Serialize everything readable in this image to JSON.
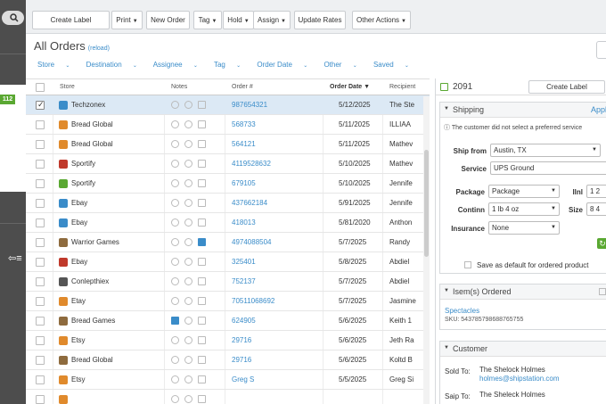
{
  "toolbar": {
    "create_label": "Create Label",
    "print": "Print",
    "new_order": "New Order",
    "tag": "Tag",
    "hold": "Hold",
    "assign": "Assign",
    "update_rates": "Update Rates",
    "other_actions": "Other Actions"
  },
  "sidebar": {
    "badge": "112"
  },
  "header": {
    "title": "All Orders",
    "reload": "(reload)"
  },
  "filters": [
    "Store",
    "Destination",
    "Assignee",
    "Tag",
    "Order Date",
    "Other",
    "Saved"
  ],
  "columns": {
    "store": "Store",
    "notes": "Notes",
    "order": "Order #",
    "date": "Order Date",
    "recipient": "Recipient"
  },
  "rows": [
    {
      "store": "Techzonex",
      "order": "987654321",
      "date": "5/12/2025",
      "recipient": "The Ste",
      "icon_color": "#3a8cc9",
      "selected": true,
      "note": false
    },
    {
      "store": "Bread Global",
      "order": "568733",
      "date": "5/11/2025",
      "recipient": "ILLIAA",
      "icon_color": "#e08a2c",
      "selected": false,
      "note": false
    },
    {
      "store": "Bread Global",
      "order": "564121",
      "date": "5/11/2025",
      "recipient": "Mathev",
      "icon_color": "#e08a2c",
      "selected": false,
      "note": false
    },
    {
      "store": "Sportify",
      "order": "4119528632",
      "date": "5/10/2025",
      "recipient": "Mathev",
      "icon_color": "#c0392b",
      "selected": false,
      "note": false
    },
    {
      "store": "Sportify",
      "order": "679105",
      "date": "5/10/2025",
      "recipient": "Jennife",
      "icon_color": "#5aa832",
      "selected": false,
      "note": false
    },
    {
      "store": "Ebay",
      "order": "437662184",
      "date": "5/91/2025",
      "recipient": "Jennife",
      "icon_color": "#3a8cc9",
      "selected": false,
      "note": false
    },
    {
      "store": "Ebay",
      "order": "418013",
      "date": "5/81/2020",
      "recipient": "Anthon",
      "icon_color": "#3a8cc9",
      "selected": false,
      "note": false
    },
    {
      "store": "Warrior Games",
      "order": "4974088504",
      "date": "5/7/2025",
      "recipient": "Randy",
      "icon_color": "#8e6b3e",
      "selected": false,
      "note": true
    },
    {
      "store": "Ebay",
      "order": "325401",
      "date": "5/8/2025",
      "recipient": "Abdiel",
      "icon_color": "#c0392b",
      "selected": false,
      "note": false
    },
    {
      "store": "Conlepthiex",
      "order": "752137",
      "date": "5/7/2025",
      "recipient": "Abdiel",
      "icon_color": "#555555",
      "selected": false,
      "note": false
    },
    {
      "store": "Etay",
      "order": "70511068692",
      "date": "5/7/2025",
      "recipient": "Jasmine",
      "icon_color": "#e08a2c",
      "selected": false,
      "note": false
    },
    {
      "store": "Bread Games",
      "order": "624905",
      "date": "5/6/2025",
      "recipient": "Keith 1",
      "icon_color": "#8e6b3e",
      "selected": false,
      "note": "first"
    },
    {
      "store": "Etsy",
      "order": "29716",
      "date": "5/6/2025",
      "recipient": "Jeth Ra",
      "icon_color": "#e08a2c",
      "selected": false,
      "note": false
    },
    {
      "store": "Bread Global",
      "order": "29716",
      "date": "5/6/2025",
      "recipient": "Koltd B",
      "icon_color": "#8e6b3e",
      "selected": false,
      "note": false
    },
    {
      "store": "Etsy",
      "order": "Greg S",
      "date": "5/5/2025",
      "recipient": "Greg Si",
      "icon_color": "#e08a2c",
      "selected": false,
      "note": false
    },
    {
      "store": "",
      "order": "",
      "date": "",
      "recipient": "",
      "icon_color": "#e08a2c",
      "selected": false,
      "note": false
    }
  ],
  "panel": {
    "order_number": "2091",
    "create_label": "Create Label",
    "shipping": {
      "title": "Shipping",
      "apply": "Appl",
      "notice": "The customer did not select a preferred service",
      "ship_from_label": "Ship from",
      "ship_from": "Austin, TX",
      "service_label": "Service",
      "service": "UPS Ground",
      "package_label": "Package",
      "package": "Package",
      "confirm_label": "Continn",
      "confirm": "1 lb 4 oz",
      "insurance_label": "Insurance",
      "insurance": "None",
      "weight_label": "llnl",
      "weight": "1 2",
      "size_label": "Size",
      "size": "8 4",
      "save_default": "Save as default for ordered product"
    },
    "items": {
      "title": "Isem(s) Ordered",
      "name": "Spectacles",
      "sku": "SKU: 543785798688765755"
    },
    "customer": {
      "title": "Customer",
      "sold_to_label": "Sold To:",
      "sold_to": "The Shelock Holmes",
      "email": "holmes@shipstation.com",
      "ship_to_label": "Saip To:",
      "ship_to": "The Sheleck Holmes"
    }
  }
}
